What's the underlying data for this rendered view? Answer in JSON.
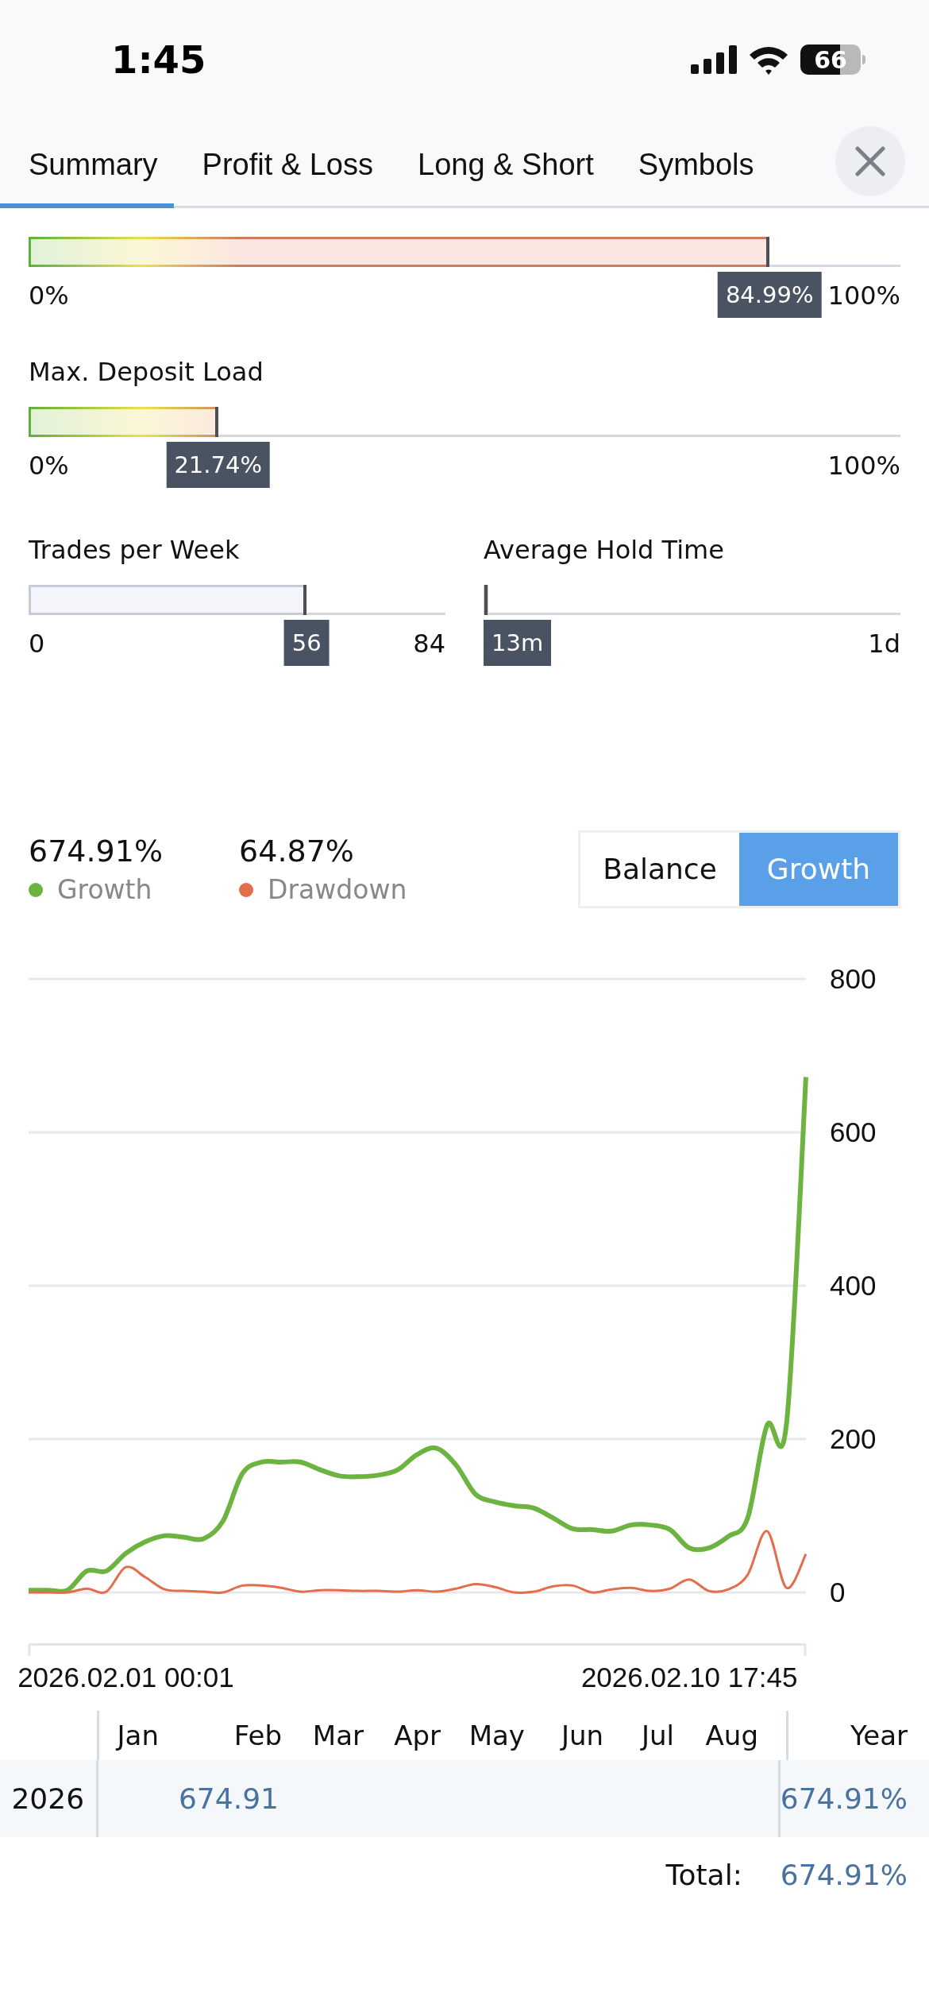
{
  "status_bar": {
    "time": "1:45",
    "battery": "66"
  },
  "tabs": [
    {
      "label": "Summary",
      "selected": true
    },
    {
      "label": "Profit & Loss",
      "selected": false
    },
    {
      "label": "Long & Short",
      "selected": false
    },
    {
      "label": "Symbols",
      "selected": false
    }
  ],
  "meters": [
    {
      "kind": "risk",
      "level": 0.8499,
      "reading": "84.99%",
      "min": "0%",
      "max": "100%"
    },
    {
      "kind": "risk",
      "title": "Max. Deposit Load",
      "level": 0.2174,
      "reading": "21.74%",
      "min": "0%",
      "max": "100%"
    }
  ],
  "half_meters": [
    {
      "kind": "plain",
      "title": "Trades per Week",
      "level": 0.667,
      "reading": "56",
      "min": "0",
      "max": "84"
    },
    {
      "kind": "plain",
      "title": "Average Hold Time",
      "level": 0.009,
      "reading": "13m",
      "max": "1d"
    }
  ],
  "stats": [
    {
      "value": "674.91%"
    },
    {
      "value": "64.87%"
    }
  ],
  "toggle": [
    {
      "label": "Balance",
      "selected": false
    },
    {
      "label": "Growth",
      "selected": true
    }
  ],
  "chart": {
    "chart_data": {
      "type": "line",
      "grid": true,
      "categories": [
        null,
        null,
        null,
        null,
        null,
        "2026.02.01 00:01",
        null,
        null,
        null,
        null,
        null,
        null,
        null,
        null,
        null,
        null,
        null,
        null,
        null,
        null,
        null,
        null,
        null,
        null,
        null,
        null,
        null,
        null,
        null,
        null,
        null,
        null,
        null,
        null,
        "2026.02.10 17:45",
        null,
        null,
        null,
        null,
        null,
        null
      ],
      "series": [
        {
          "name": "Growth",
          "color": "#6cb33f",
          "values": [
            3,
            3,
            3,
            28,
            28,
            51,
            66,
            74,
            72,
            70,
            93,
            155,
            170,
            170,
            170,
            160,
            152,
            151,
            153,
            160,
            180,
            188,
            166,
            128,
            118,
            113,
            110,
            97,
            83,
            82,
            80,
            88,
            88,
            82,
            58,
            58,
            73,
            97,
            218,
            220,
            672
          ]
        },
        {
          "name": "Drawdown",
          "color": "#e46d4b",
          "values": [
            0,
            0,
            0,
            5,
            1,
            33,
            20,
            4,
            2,
            1,
            0,
            9,
            9,
            6,
            1,
            3,
            3,
            2,
            2,
            1,
            3,
            1,
            5,
            11,
            7,
            0,
            1,
            8,
            9,
            0,
            4,
            6,
            2,
            5,
            17,
            2,
            4,
            23,
            80,
            6,
            50
          ]
        }
      ],
      "ylim": [
        -70,
        800
      ],
      "yticks": [
        0,
        200,
        400,
        600,
        800
      ]
    }
  },
  "table": {
    "columns": [
      "Jan",
      "Feb",
      "Mar",
      "Apr",
      "May",
      "Jun",
      "Jul",
      "Aug"
    ],
    "year_column": "Year",
    "rows": [
      {
        "year": "2026",
        "cells": [
          {
            "kind": "empty"
          },
          {
            "kind": "value",
            "text": "674.91"
          },
          {
            "kind": "empty"
          },
          {
            "kind": "empty"
          },
          {
            "kind": "empty"
          },
          {
            "kind": "empty"
          },
          {
            "kind": "empty"
          },
          {
            "kind": "empty"
          }
        ],
        "total": "674.91%"
      }
    ],
    "total_label": "Total:",
    "total": "674.91%"
  }
}
